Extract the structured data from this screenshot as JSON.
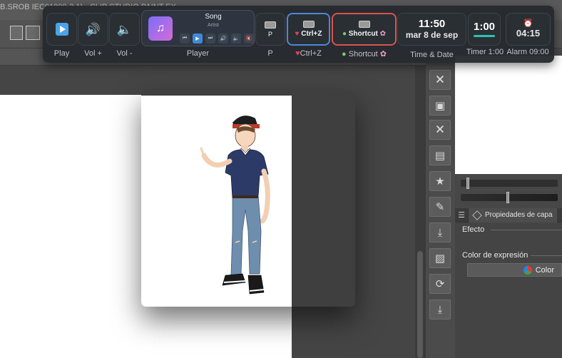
{
  "app": {
    "title": "B.SROB IEC01900-2.1) - CLIP STUDIO PAINT EX"
  },
  "tools": {
    "buttons": [
      {
        "name": "clear-layer",
        "glyph": "🗙"
      },
      {
        "name": "layer-settings",
        "glyph": "▣"
      },
      {
        "name": "clear-outside",
        "glyph": "🗙"
      },
      {
        "name": "grid-settings",
        "glyph": "▤"
      },
      {
        "name": "favorite-layer",
        "glyph": "★"
      },
      {
        "name": "edit-layer",
        "glyph": "✎"
      },
      {
        "name": "merge-down",
        "glyph": "⤓"
      },
      {
        "name": "extract-lines",
        "glyph": "▨"
      },
      {
        "name": "rotate-layer",
        "glyph": "⟳"
      },
      {
        "name": "download-layer",
        "glyph": "⤓"
      }
    ]
  },
  "properties": {
    "tab_label": "Propiedades de capa",
    "effect_label": "Efecto",
    "expression_color_label": "Color de expresión",
    "color_button": "Color"
  },
  "deck": {
    "keys": {
      "play": {
        "label": "Play"
      },
      "vol_up": {
        "label": "Vol +"
      },
      "vol_down": {
        "label": "Vol -"
      },
      "player": {
        "label": "Player",
        "song": "Song",
        "artist": "Artist"
      },
      "p": {
        "label": "P",
        "key_text": "P"
      },
      "ctrl_z": {
        "label": "Ctrl+Z",
        "key_text": "Ctrl+Z"
      },
      "shortcut": {
        "label": "Shortcut",
        "key_text": "Shortcut"
      },
      "time_date": {
        "label": "Time & Date",
        "time": "11:50",
        "date": "mar 8 de sep"
      },
      "timer": {
        "label": "Timer 1:00",
        "value": "1:00"
      },
      "alarm": {
        "label": "Alarm 09:00",
        "value": "04:15"
      }
    },
    "colors": {
      "ctrl_z_border": "#4f86d9",
      "shortcut_border": "#d9534f",
      "timer_accent": "#29c4b2"
    }
  }
}
